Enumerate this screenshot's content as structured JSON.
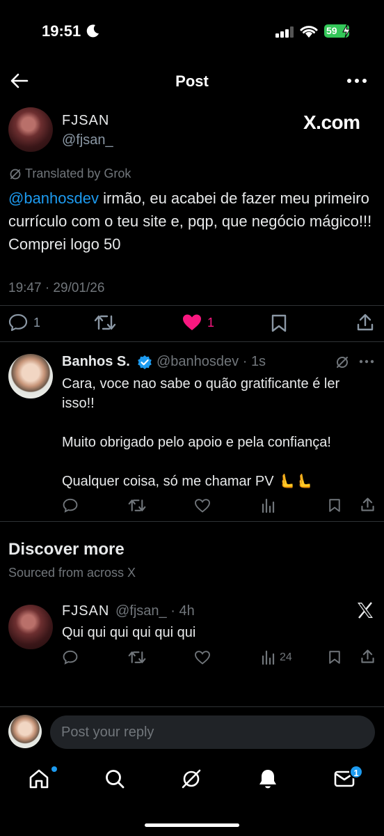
{
  "status_bar": {
    "time": "19:51",
    "battery": "59"
  },
  "header": {
    "title": "Post"
  },
  "post": {
    "author_name": "FJSAN",
    "author_handle": "@fjsan_",
    "source_label": "X.com",
    "translated_label": "Translated by Grok",
    "mention": "@banhosdev",
    "text": " irmão, eu acabei de fazer meu primeiro currículo com o teu site e, pqp, que negócio mágico!!! Comprei logo 50",
    "timestamp": "19:47 · 29/01/26",
    "replies": "1",
    "likes": "1"
  },
  "reply": {
    "author_name": "Banhos S.",
    "author_handle": "@banhosdev · 1s",
    "text": "Cara, voce nao sabe o quão gratificante é ler isso!!\n\nMuito obrigado pelo apoio e pela confiança!\n\nQualquer coisa, só me chamar PV 🫷🫷"
  },
  "discover": {
    "title": "Discover more",
    "subtitle": "Sourced from across X",
    "post": {
      "author_name": "FJSAN",
      "author_handle": "@fjsan_ · 4h",
      "text": "Qui qui qui qui qui qui",
      "views": "24"
    }
  },
  "composer": {
    "placeholder": "Post your reply"
  },
  "nav": {
    "messages_badge": "1"
  },
  "colors": {
    "accent": "#1d9bf0",
    "like": "#f91880",
    "background": "#000000"
  },
  "icons": [
    "back-arrow-icon",
    "more-icon",
    "grok-icon",
    "reply-icon",
    "repost-icon",
    "heart-icon",
    "bookmark-icon",
    "share-icon",
    "verified-icon",
    "views-icon",
    "x-logo-icon",
    "home-icon",
    "search-icon",
    "messages-icon",
    "notifications-icon"
  ]
}
